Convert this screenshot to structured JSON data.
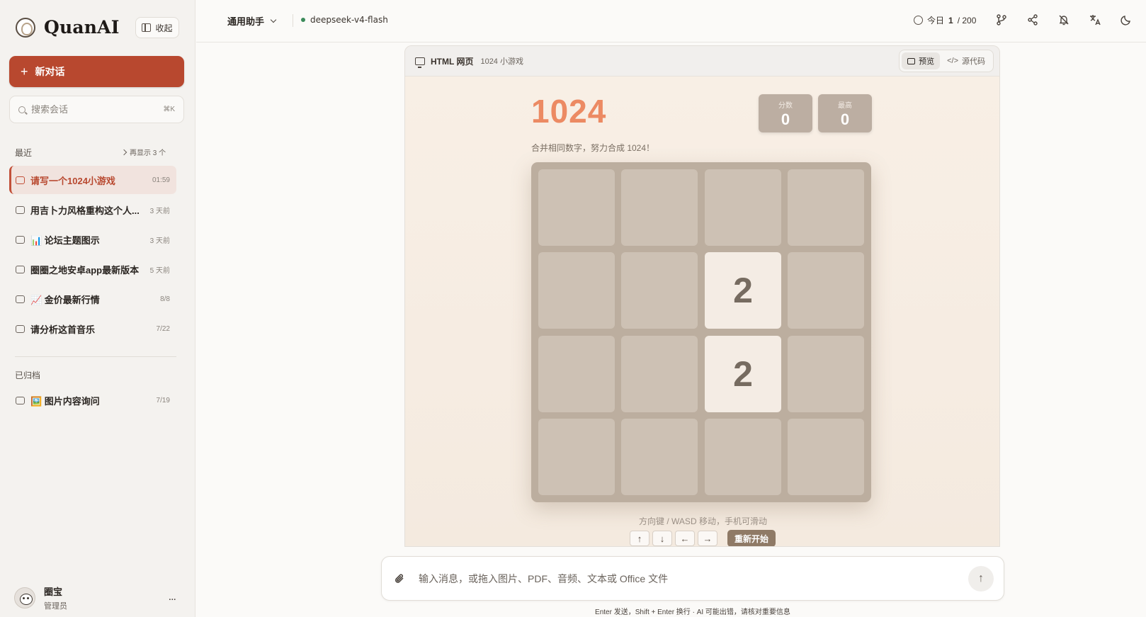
{
  "sidebar": {
    "brand": "QuanAI",
    "collapse_label": "收起",
    "new_chat_label": "新对话",
    "search": {
      "placeholder": "搜索会话",
      "shortcut": "⌘K"
    },
    "recent_label": "最近",
    "show_more_label": "再显示 3 个",
    "recent_items": [
      {
        "title": "请写一个1024小游戏",
        "time": "01:59",
        "active": true
      },
      {
        "title": "用吉卜力风格重构这个人...",
        "time": "3 天前"
      },
      {
        "title": "📊 论坛主题图示",
        "time": "3 天前"
      },
      {
        "title": "圈圈之地安卓app最新版本",
        "time": "5 天前"
      },
      {
        "title": "📈 金价最新行情",
        "time": "8/8"
      },
      {
        "title": "请分析这首音乐",
        "time": "7/22"
      }
    ],
    "archived_label": "已归档",
    "archived_items": [
      {
        "title": "🖼️ 图片内容询问",
        "time": "7/19"
      }
    ],
    "user": {
      "name": "圈宝",
      "role": "管理员",
      "more": "..."
    }
  },
  "topbar": {
    "assistant": "通用助手",
    "model": "deepseek-v4-flash",
    "quota_prefix": "今日",
    "quota_used": "1",
    "quota_total": "/ 200",
    "icons": [
      "branch-icon",
      "share-icon",
      "bell-off-icon",
      "translate-icon",
      "moon-icon"
    ]
  },
  "preview": {
    "type_label": "HTML 网页",
    "name": "1024 小游戏",
    "tab_preview": "预览",
    "tab_source": "源代码",
    "game": {
      "title": "1024",
      "score_label": "分数",
      "score": "0",
      "best_label": "最高",
      "best": "0",
      "subtitle": "合并相同数字，努力合成 1024！",
      "grid": [
        [
          "",
          "",
          "",
          ""
        ],
        [
          "",
          "",
          "2",
          ""
        ],
        [
          "",
          "",
          "2",
          ""
        ],
        [
          "",
          "",
          "",
          ""
        ]
      ],
      "hint": "方向键 / WASD 移动，手机可滑动",
      "keys": [
        "↑",
        "↓",
        "←",
        "→"
      ],
      "restart": "重新开始"
    }
  },
  "composer": {
    "placeholder": "输入消息，或拖入图片、PDF、音频、文本或 Office 文件",
    "send_icon": "↑",
    "footnote": "Enter 发送，Shift + Enter 换行 · AI 可能出错，请核对重要信息"
  },
  "colors": {
    "accent": "#b8482f",
    "game_title": "#ec8a63",
    "board": "#bcae9f",
    "tile_empty": "#cdc1b4",
    "tile_2": "#f4ece4",
    "restart": "#8f7a66"
  }
}
